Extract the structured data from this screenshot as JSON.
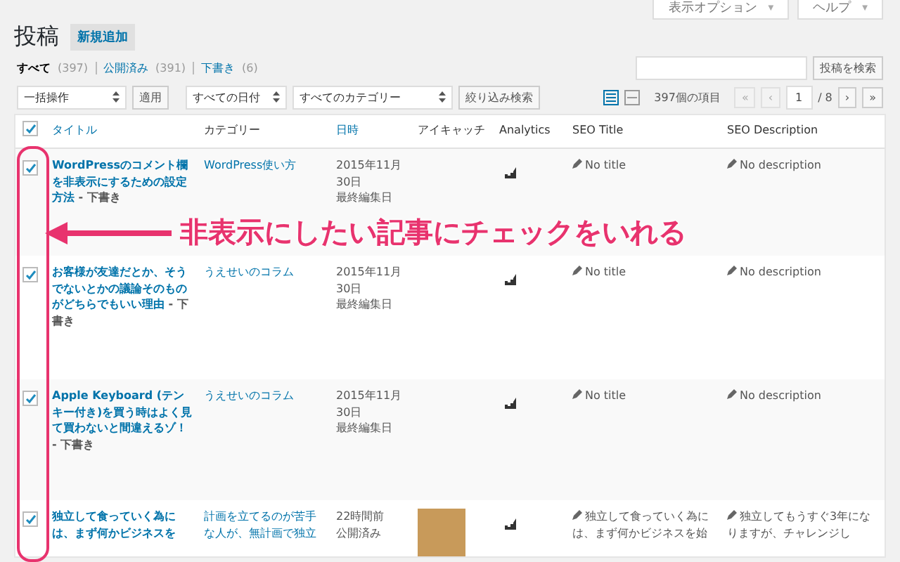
{
  "header": {
    "title": "投稿",
    "add_new": "新規追加"
  },
  "screen_tabs": [
    {
      "label": "表示オプション",
      "caret": "▼"
    },
    {
      "label": "ヘルプ",
      "caret": "▼"
    }
  ],
  "status_links": [
    {
      "label": "すべて",
      "count": "(397)",
      "selected": true
    },
    {
      "label": "公開済み",
      "count": "(391)",
      "selected": false
    },
    {
      "label": "下書き",
      "count": "(6)",
      "selected": false
    }
  ],
  "search": {
    "button": "投稿を検索"
  },
  "filters": {
    "bulk": {
      "value": "一括操作",
      "apply": "適用"
    },
    "date": "すべての日付",
    "category": "すべてのカテゴリー",
    "filter_button": "絞り込み検索"
  },
  "view_modes": [
    {
      "kind": "list",
      "selected": true
    },
    {
      "kind": "excerpt",
      "selected": false
    }
  ],
  "pagination": {
    "count": "397個の項目",
    "first": {
      "label": "«",
      "disabled": true
    },
    "prev": {
      "label": "‹",
      "disabled": true
    },
    "page": "1",
    "total": "/ 8",
    "next": {
      "label": "›",
      "disabled": false
    },
    "last": {
      "label": "»",
      "disabled": false
    }
  },
  "table": {
    "select_all_checked": true,
    "columns": [
      {
        "label": "タイトル",
        "sortable": true
      },
      {
        "label": "カテゴリー",
        "sortable": false
      },
      {
        "label": "日時",
        "sortable": true
      },
      {
        "label": "アイキャッチ",
        "sortable": false
      },
      {
        "label": "Analytics",
        "sortable": false
      },
      {
        "label": "SEO Title",
        "sortable": false
      },
      {
        "label": "SEO Description",
        "sortable": false
      }
    ],
    "rows": [
      {
        "checked": true,
        "title": "WordPressのコメント欄を非表示にするための設定方法",
        "state": " - 下書き",
        "category": "WordPress使い方",
        "date": [
          "2015年11月",
          "30日",
          "最終編集日"
        ],
        "thumbnail": false,
        "seo_title": "No title",
        "seo_description": "No description"
      },
      {
        "checked": true,
        "title": "お客様が友達だとか、そうでないとかの議論そのものがどちらでもいい理由",
        "state": " - 下書き",
        "category": "うえせいのコラム",
        "date": [
          "2015年11月",
          "30日",
          "最終編集日"
        ],
        "thumbnail": false,
        "seo_title": "No title",
        "seo_description": "No description"
      },
      {
        "checked": true,
        "title": "Apple Keyboard (テンキー付き)を買う時はよく見て買わないと間違えるゾ！",
        "state": " - 下書き",
        "category": "うえせいのコラム",
        "date": [
          "2015年11月",
          "30日",
          "最終編集日"
        ],
        "thumbnail": false,
        "seo_title": "No title",
        "seo_description": "No description"
      },
      {
        "checked": true,
        "title": "独立して食っていく為には、まず何かビジネスを",
        "state": "",
        "category": "計画を立てるのが苦手な人が、無計画で独立",
        "date": [
          "22時間前",
          "公開済み"
        ],
        "thumbnail": true,
        "seo_title": "独立して食っていく為には、まず何かビジネスを始",
        "seo_description": "独立してもうすぐ3年になりますが、チャレンジし"
      }
    ]
  },
  "annotation": {
    "text": "非表示にしたい記事にチェックをいれる"
  }
}
